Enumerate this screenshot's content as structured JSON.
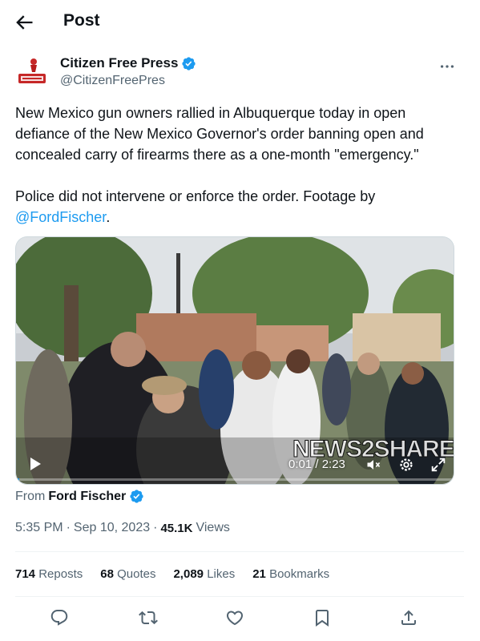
{
  "header": {
    "title": "Post",
    "back_icon": "arrow-left-icon"
  },
  "author": {
    "name": "Citizen Free Press",
    "handle": "@CitizenFreePres",
    "verified": true,
    "avatar_icon": "citizen-free-press-logo",
    "more_icon": "more-horizontal-icon"
  },
  "tweet": {
    "text_part1": "New Mexico gun owners rallied in Albuquerque today in open defiance of the New Mexico Governor's order banning open and concealed carry of firearms there as a one-month \"emergency.\"\n\nPolice did not intervene or enforce the order. Footage by\n",
    "mention": "@FordFischer",
    "text_end": "."
  },
  "video": {
    "time": "0:01 / 2:23",
    "progress": 0.007,
    "watermark": "NEWS2SHARE",
    "play_icon": "play-icon",
    "mute_icon": "volume-mute-icon",
    "settings_icon": "gear-icon",
    "fullscreen_icon": "fullscreen-icon"
  },
  "source": {
    "prefix": "From ",
    "name": "Ford Fischer",
    "verified": true
  },
  "meta": {
    "time": "5:35 PM",
    "date": "Sep 10, 2023",
    "views": "45.1K",
    "views_label": "Views",
    "separator": "·"
  },
  "stats": {
    "reposts": {
      "count": "714",
      "label": "Reposts"
    },
    "quotes": {
      "count": "68",
      "label": "Quotes"
    },
    "likes": {
      "count": "2,089",
      "label": "Likes"
    },
    "bookmarks": {
      "count": "21",
      "label": "Bookmarks"
    }
  },
  "actions": [
    "reply-icon",
    "repost-icon",
    "like-icon",
    "bookmark-icon",
    "share-icon"
  ],
  "colors": {
    "accent": "#1d9bf0",
    "text": "#0f1419",
    "secondary": "#536471",
    "divider": "#eff3f4"
  }
}
